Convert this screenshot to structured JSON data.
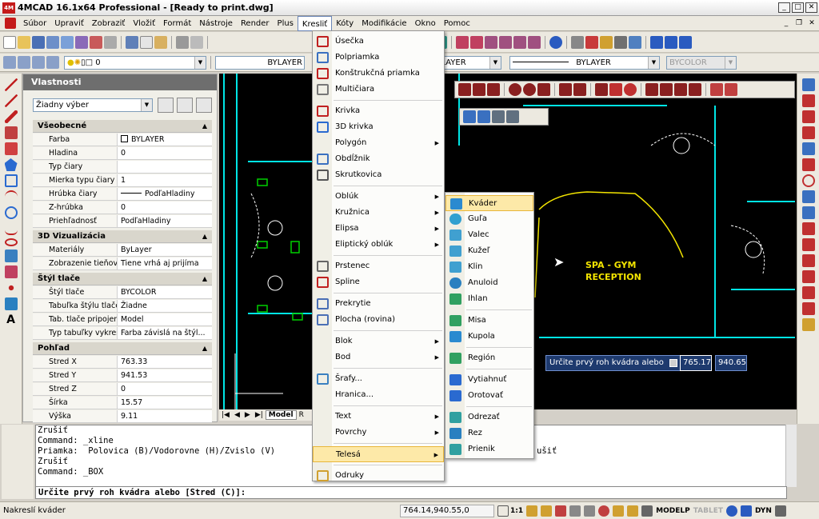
{
  "window": {
    "logo": "4M",
    "title": "4MCAD 16.1x64 Professional - [Ready to print.dwg]"
  },
  "menubar": [
    "Súbor",
    "Upraviť",
    "Zobraziť",
    "Vložiť",
    "Formát",
    "Nástroje",
    "Render",
    "Plus",
    "Kresliť",
    "Kóty",
    "Modifikácie",
    "Okno",
    "Pomoc"
  ],
  "toolbar2": {
    "layer_value": "0",
    "linetype_value": "BYLAYER",
    "linetype_value2": "BYLAYER",
    "lineweight_value": "BYLAYER",
    "color_value": "BYCOLOR"
  },
  "properties": {
    "title": "Vlastnosti",
    "selection": "Žiadny výber",
    "sections": [
      {
        "name": "Všeobecné",
        "rows": [
          {
            "k": "Farba",
            "v": "BYLAYER"
          },
          {
            "k": "Hladina",
            "v": "0"
          },
          {
            "k": "Typ čiary",
            "v": ""
          },
          {
            "k": "Mierka typu čiary",
            "v": "1"
          },
          {
            "k": "Hrúbka čiary",
            "v": "PodľaHladiny"
          },
          {
            "k": "Z-hrúbka",
            "v": "0"
          },
          {
            "k": "Priehľadnosť",
            "v": "PodľaHladiny"
          }
        ]
      },
      {
        "name": "3D Vizualizácia",
        "rows": [
          {
            "k": "Materiály",
            "v": "ByLayer"
          },
          {
            "k": "Zobrazenie tieňov",
            "v": "Tiene vrhá aj prijíma"
          }
        ]
      },
      {
        "name": "Štýl tlače",
        "rows": [
          {
            "k": "Štýl tlače",
            "v": "BYCOLOR"
          },
          {
            "k": "Tabuľka štýlu tlače",
            "v": "Žiadne"
          },
          {
            "k": "Tab. tlače pripojená k",
            "v": "Model"
          },
          {
            "k": "Typ tabuľky vykresl...",
            "v": "Farba závislá na štýl..."
          }
        ]
      },
      {
        "name": "Pohľad",
        "rows": [
          {
            "k": "Stred X",
            "v": "763.33"
          },
          {
            "k": "Stred Y",
            "v": "941.53"
          },
          {
            "k": "Stred Z",
            "v": "0"
          },
          {
            "k": "Šírka",
            "v": "15.57"
          },
          {
            "k": "Výška",
            "v": "9.11"
          }
        ]
      }
    ]
  },
  "drawing": {
    "label1": "SPA - GYM",
    "label2": "RECEPTION",
    "tooltip_prompt": "Určite prvý roh kvádra alebo",
    "x_input": "765.17",
    "y_input": "940.65",
    "tab_model": "Model",
    "tab_layout": "R"
  },
  "kreslit_menu": [
    {
      "label": "Úsečka",
      "icon": "line-icon",
      "arrow": ""
    },
    {
      "label": "Polpriamka",
      "icon": "ray-icon",
      "arrow": ""
    },
    {
      "label": "Konštrukčná priamka",
      "icon": "xline-icon",
      "arrow": ""
    },
    {
      "label": "Multičiara",
      "icon": "mline-icon",
      "arrow": ""
    },
    {
      "label": "Krivka",
      "icon": "polyline-icon",
      "arrow": ""
    },
    {
      "label": "3D krivka",
      "icon": "3d-polyline-icon",
      "arrow": ""
    },
    {
      "label": "Polygón",
      "icon": "",
      "arrow": "▶"
    },
    {
      "label": "Obdĺžnik",
      "icon": "rectangle-icon",
      "arrow": ""
    },
    {
      "label": "Skrutkovica",
      "icon": "helix-icon",
      "arrow": ""
    },
    {
      "label": "Oblúk",
      "icon": "",
      "arrow": "▶"
    },
    {
      "label": "Kružnica",
      "icon": "",
      "arrow": "▶"
    },
    {
      "label": "Elipsa",
      "icon": "",
      "arrow": "▶"
    },
    {
      "label": "Eliptický oblúk",
      "icon": "",
      "arrow": "▶"
    },
    {
      "label": "Prstenec",
      "icon": "donut-icon",
      "arrow": ""
    },
    {
      "label": "Spline",
      "icon": "spline-icon",
      "arrow": ""
    },
    {
      "label": "Prekrytie",
      "icon": "wipeout-icon",
      "arrow": ""
    },
    {
      "label": "Plocha (rovina)",
      "icon": "plane-icon",
      "arrow": ""
    },
    {
      "label": "Blok",
      "icon": "",
      "arrow": "▶"
    },
    {
      "label": "Bod",
      "icon": "",
      "arrow": "▶"
    },
    {
      "label": "Šrafy...",
      "icon": "hatch-icon",
      "arrow": ""
    },
    {
      "label": "Hranica...",
      "icon": "",
      "arrow": ""
    },
    {
      "label": "Text",
      "icon": "",
      "arrow": "▶"
    },
    {
      "label": "Povrchy",
      "icon": "",
      "arrow": "▶"
    },
    {
      "label": "Telesá",
      "icon": "",
      "arrow": "▶"
    },
    {
      "label": "Odruky",
      "icon": "revcloud-icon",
      "arrow": ""
    }
  ],
  "telesa_menu": [
    {
      "label": "Kváder",
      "icon": "box-icon"
    },
    {
      "label": "Guľa",
      "icon": "sphere-icon"
    },
    {
      "label": "Valec",
      "icon": "cylinder-icon"
    },
    {
      "label": "Kužeľ",
      "icon": "cone-icon"
    },
    {
      "label": "Klin",
      "icon": "wedge-icon"
    },
    {
      "label": "Anuloid",
      "icon": "torus-icon"
    },
    {
      "label": "Ihlan",
      "icon": "pyramid-icon"
    },
    {
      "label": "Misa",
      "icon": "dish-icon"
    },
    {
      "label": "Kupola",
      "icon": "dome-icon"
    },
    {
      "label": "Región",
      "icon": "region-icon"
    },
    {
      "label": "Vytiahnuť",
      "icon": "extrude-icon"
    },
    {
      "label": "Orotovať",
      "icon": "revolve-icon"
    },
    {
      "label": "Odrezať",
      "icon": "slice-icon"
    },
    {
      "label": "Rez",
      "icon": "section-icon"
    },
    {
      "label": "Prienik",
      "icon": "interfere-icon"
    }
  ],
  "command": {
    "lines": [
      "Zrušiť",
      "Command: _xline",
      "Priamka:  Polovica (B)/Vodorovne (H)/Zvislo (V)",
      "Zrušiť",
      "Command: _BOX"
    ],
    "line_tail": "ušiť",
    "prompt": "Určite prvý roh kvádra alebo [Stred (C)]:"
  },
  "status": {
    "message": "Nakreslí kváder",
    "coords": "764.14,940.55,0",
    "scale": "1:1",
    "modelp": "MODELP",
    "tablet": "TABLET",
    "dyn": "DYN"
  },
  "colors": {
    "accent_menu_highlight": "#fde9a8",
    "canvas": "#000000",
    "cyan": "#00e5e5",
    "yellow": "#f2e400",
    "green": "#00d000"
  }
}
